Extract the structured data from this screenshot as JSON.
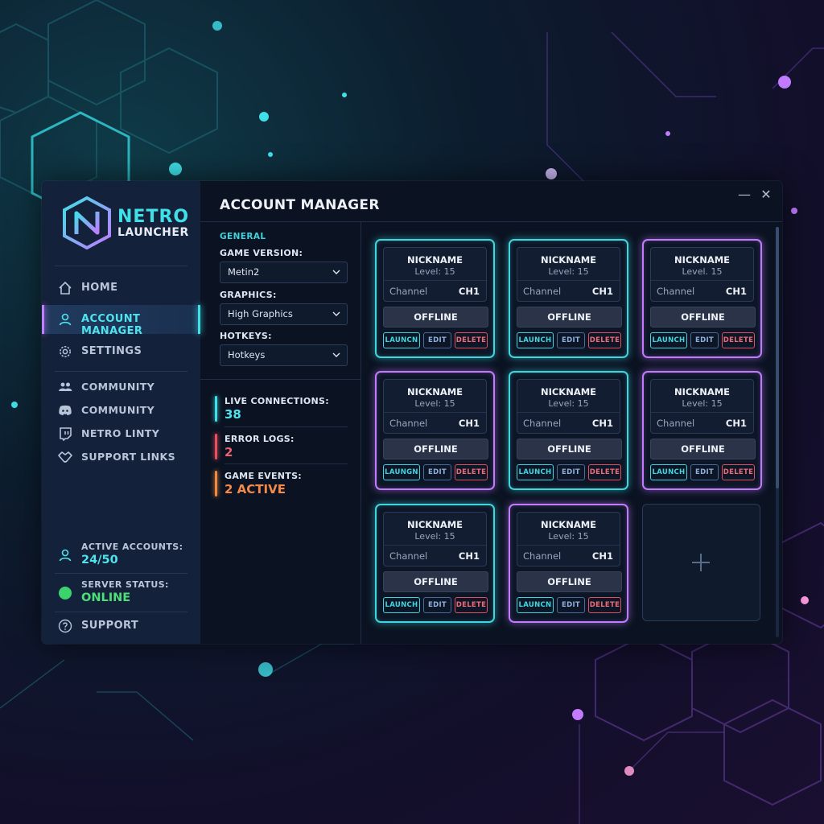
{
  "app": {
    "logo_line1": "NETRO",
    "logo_line2": "LAUNCHER",
    "title": "ACCOUNT MANAGER",
    "accent_cyan": "#3fe0e8",
    "accent_purple": "#c27bff"
  },
  "window_controls": {
    "minimize_icon": "minimize-icon",
    "close_icon": "close-icon"
  },
  "sidebar": {
    "nav": [
      {
        "label": "HOME",
        "icon": "home-icon",
        "active": false
      },
      {
        "label": "ACCOUNT MANAGER",
        "icon": "user-icon",
        "active": true
      },
      {
        "label": "SETTINGS",
        "icon": "gear-icon",
        "active": false
      }
    ],
    "links": [
      {
        "label": "COMMUNITY",
        "icon": "users-icon"
      },
      {
        "label": "COMMUNITY",
        "icon": "discord-icon"
      },
      {
        "label": "NETRO LINTY",
        "icon": "twitch-icon"
      },
      {
        "label": "SUPPORT LINKS",
        "icon": "handshake-icon"
      }
    ],
    "active_accounts_label": "ACTIVE ACCOUNTS:",
    "active_accounts_value": "24/50",
    "server_status_label": "SERVER STATUS:",
    "server_status_value": "ONLINE",
    "support_label": "SUPPORT"
  },
  "settings": {
    "section": "GENERAL",
    "game_version_label": "GAME VERSION:",
    "game_version_value": "Metin2",
    "graphics_label": "GRAPHICS:",
    "graphics_value": "High Graphics",
    "hotkeys_label": "HOTKEYS:",
    "hotkeys_value": "Hotkeys"
  },
  "metrics": {
    "live_label": "LIVE CONNECTIONS:",
    "live_value": "38",
    "errors_label": "ERROR LOGS:",
    "errors_value": "2",
    "events_label": "GAME EVENTS:",
    "events_value": "2 ACTIVE"
  },
  "cards": [
    {
      "nickname": "NICKNAME",
      "level": "Level: 15",
      "channel_label": "Channel",
      "channel": "CH1",
      "status": "OFFLINE",
      "launch": "LAUNCN",
      "edit": "EDIT",
      "delete": "DELETE",
      "color": "cyan"
    },
    {
      "nickname": "NICKNAME",
      "level": "Level: 15",
      "channel_label": "Channel",
      "channel": "CH1",
      "status": "OFFLINE",
      "launch": "LAUNCH",
      "edit": "EDIT",
      "delete": "DELETE",
      "color": "cyan"
    },
    {
      "nickname": "NICKNAME",
      "level": "Level. 15",
      "channel_label": "Channel",
      "channel": "CH1",
      "status": "OFFLINE",
      "launch": "LAUNCH",
      "edit": "EDIT",
      "delete": "DELETE",
      "color": "purple"
    },
    {
      "nickname": "NICKNAME",
      "level": "Level: 15",
      "channel_label": "Channel",
      "channel": "CH1",
      "status": "OFFLINE",
      "launch": "LAUNGN",
      "edit": "EDIT",
      "delete": "DELETE",
      "color": "purple"
    },
    {
      "nickname": "NICKNAME",
      "level": "Level: 15",
      "channel_label": "Channel",
      "channel": "CH1",
      "status": "OFFLINE",
      "launch": "LAUNCH",
      "edit": "EDIT",
      "delete": "DELETE",
      "color": "cyan"
    },
    {
      "nickname": "NICKNAME",
      "level": "Level: 15",
      "channel_label": "Channel",
      "channel": "CH1",
      "status": "OFFLINE",
      "launch": "LAUNCH",
      "edit": "EDIT",
      "delete": "DELETE",
      "color": "purple"
    },
    {
      "nickname": "NICKNAME",
      "level": "Level: 15",
      "channel_label": "Channel",
      "channel": "CH1",
      "status": "OFFLINE",
      "launch": "LAUNCH",
      "edit": "EDIT",
      "delete": "DELETE",
      "color": "cyan"
    },
    {
      "nickname": "NICKNAME",
      "level": "Level: 15",
      "channel_label": "Channel",
      "channel": "CH1",
      "status": "OFFLINE",
      "launch": "LAUNCN",
      "edit": "EDIT",
      "delete": "DELETE",
      "color": "purple"
    }
  ],
  "add_card": {
    "icon": "plus-icon"
  }
}
